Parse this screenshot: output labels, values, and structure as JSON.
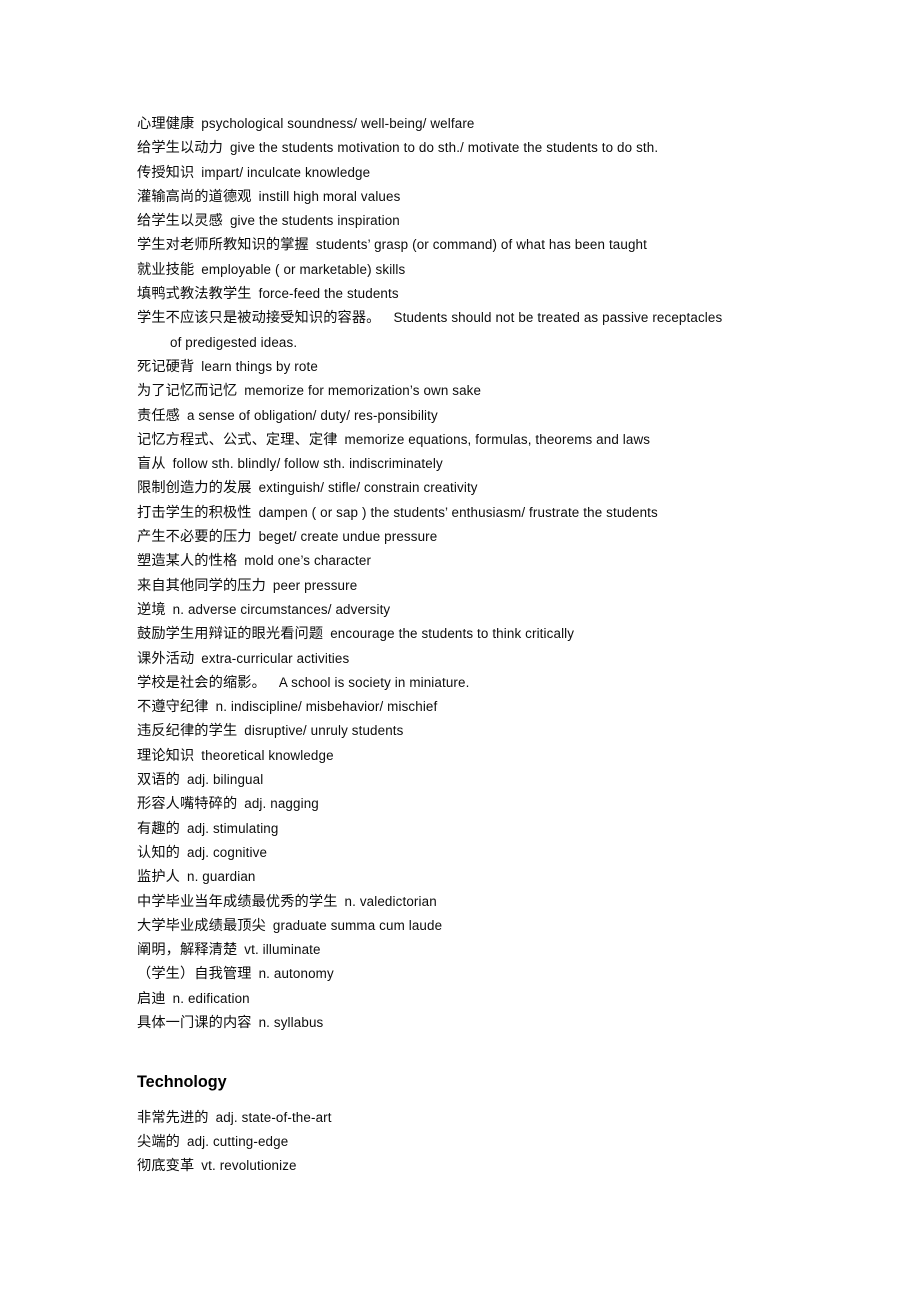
{
  "document": {
    "title": "Vocabulary Glossary — Education / Technology",
    "page_background": "#ffffff",
    "text_color": "#0c0c0c"
  },
  "sections": [
    {
      "heading": null,
      "entries": [
        {
          "cn": "心理健康",
          "en": "psychological soundness/ well-being/ welfare"
        },
        {
          "cn": "给学生以动力",
          "en": "give the students motivation to do sth./ motivate the students to do sth."
        },
        {
          "cn": "传授知识",
          "en": "impart/ inculcate knowledge"
        },
        {
          "cn": "灌输高尚的道德观",
          "en": "instill high moral values"
        },
        {
          "cn": "给学生以灵感",
          "en": "give the students inspiration"
        },
        {
          "cn": "学生对老师所教知识的掌握",
          "en": "students’ grasp (or command) of what has been taught"
        },
        {
          "cn": "就业技能",
          "en": "employable ( or marketable) skills"
        },
        {
          "cn": "填鸭式教法教学生",
          "en": "force-feed the students"
        },
        {
          "cn": "学生不应该只是被动接受知识的容器。",
          "en": "Students should not be treated as passive receptacles",
          "wide_sep": true
        },
        {
          "cn": "",
          "en": "of predigested ideas.",
          "continuation": true
        },
        {
          "cn": "死记硬背",
          "en": "learn things by rote"
        },
        {
          "cn": "为了记忆而记忆",
          "en": "memorize for memorization’s own sake"
        },
        {
          "cn": "责任感",
          "en": "a sense of obligation/ duty/ res-ponsibility"
        },
        {
          "cn": "记忆方程式、公式、定理、定律",
          "en": "memorize equations, formulas, theorems and laws"
        },
        {
          "cn": "盲从",
          "en": "follow sth. blindly/ follow sth. indiscriminately"
        },
        {
          "cn": "限制创造力的发展",
          "en": "extinguish/ stifle/ constrain creativity"
        },
        {
          "cn": "打击学生的积极性",
          "en": "dampen ( or sap ) the students’ enthusiasm/ frustrate the students"
        },
        {
          "cn": "产生不必要的压力",
          "en": "beget/ create undue pressure"
        },
        {
          "cn": "塑造某人的性格",
          "en": "mold one’s character"
        },
        {
          "cn": "来自其他同学的压力",
          "en": "peer pressure"
        },
        {
          "cn": "逆境",
          "en": "n. adverse circumstances/ adversity"
        },
        {
          "cn": "鼓励学生用辩证的眼光看问题",
          "en": "encourage the students to think critically"
        },
        {
          "cn": "课外活动",
          "en": "extra-curricular activities"
        },
        {
          "cn": "学校是社会的缩影。",
          "en": "A school is society in miniature.",
          "wide_sep": true
        },
        {
          "cn": "不遵守纪律",
          "en": "n. indiscipline/ misbehavior/ mischief"
        },
        {
          "cn": "违反纪律的学生",
          "en": "disruptive/ unruly students"
        },
        {
          "cn": "理论知识",
          "en": "theoretical knowledge"
        },
        {
          "cn": "双语的",
          "en": "adj. bilingual"
        },
        {
          "cn": "形容人嘴特碎的",
          "en": "adj. nagging"
        },
        {
          "cn": "有趣的",
          "en": "adj. stimulating"
        },
        {
          "cn": "认知的",
          "en": "adj. cognitive"
        },
        {
          "cn": "监护人",
          "en": "n. guardian"
        },
        {
          "cn": "中学毕业当年成绩最优秀的学生",
          "en": "n. valedictorian"
        },
        {
          "cn": "大学毕业成绩最顶尖",
          "en": "graduate summa cum laude"
        },
        {
          "cn": "阐明，解释清楚",
          "en": "vt. illuminate"
        },
        {
          "cn": "（学生）自我管理",
          "en": "n. autonomy"
        },
        {
          "cn": "启迪",
          "en": "n. edification"
        },
        {
          "cn": "具体一门课的内容",
          "en": "n. syllabus"
        }
      ]
    },
    {
      "heading": "Technology",
      "entries": [
        {
          "cn": "非常先进的",
          "en": "adj. state-of-the-art"
        },
        {
          "cn": "尖端的",
          "en": "adj. cutting-edge"
        },
        {
          "cn": "彻底变革",
          "en": "vt. revolutionize"
        }
      ]
    }
  ]
}
